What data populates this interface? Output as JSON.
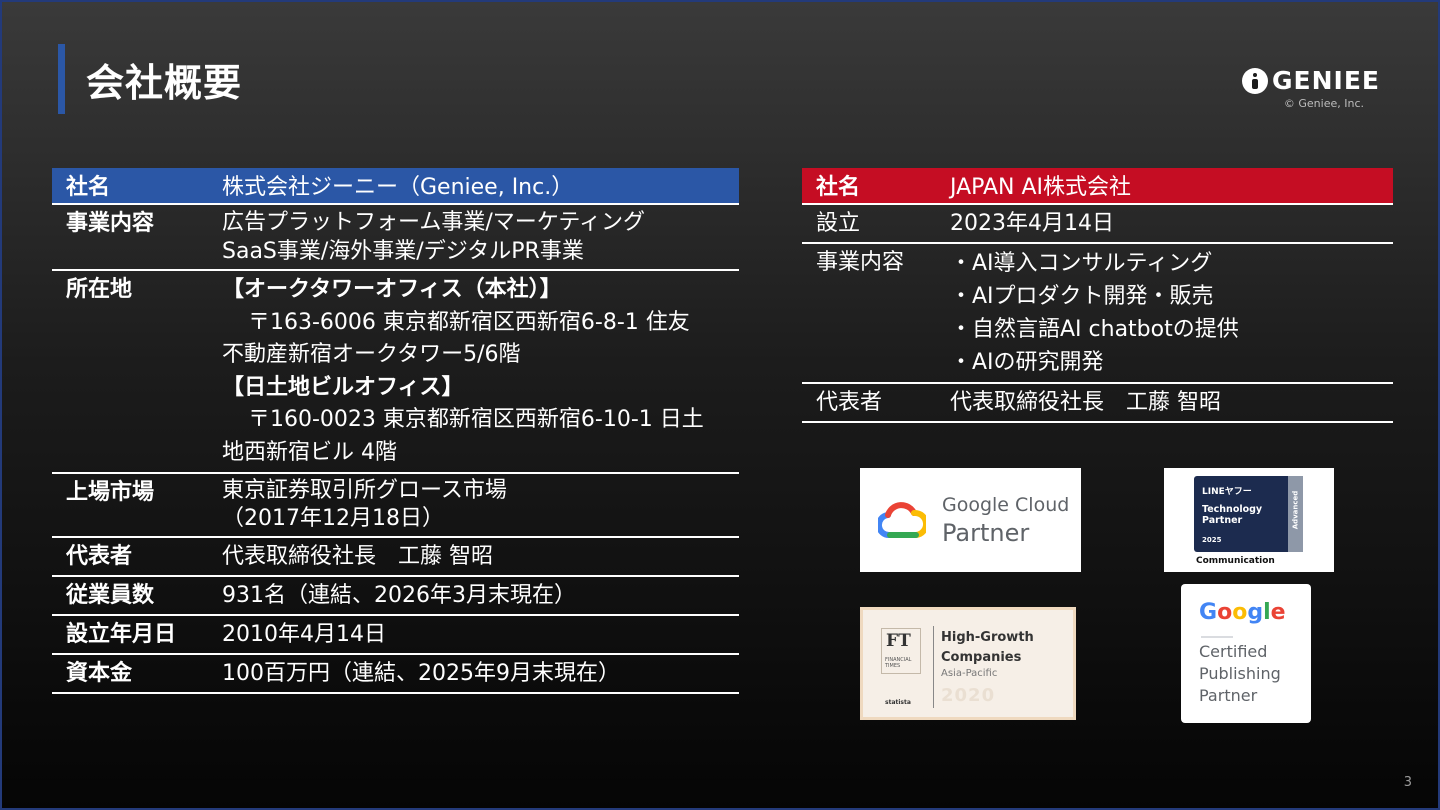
{
  "header": {
    "title": "会社概要",
    "logo_text": "GENIEE",
    "copyright": "© Geniee, Inc."
  },
  "colors": {
    "accent_blue": "#2b57a6",
    "accent_red": "#c50d23"
  },
  "geniee_table": {
    "rows": [
      {
        "label": "社名",
        "lines": [
          "株式会社ジーニー（Geniee, Inc.）"
        ]
      },
      {
        "label": "事業内容",
        "lines": [
          "広告プラットフォーム事業/マーケティング",
          "SaaS事業/海外事業/デジタルPR事業"
        ]
      },
      {
        "label": "所在地",
        "lines": [
          "【オークタワーオフィス（本社）】",
          "〒163-6006 東京都新宿区西新宿6-8-1 住友",
          "不動産新宿オークタワー5/6階",
          "【日土地ビルオフィス】",
          "〒160-0023 東京都新宿区西新宿6-10-1 日土",
          "地西新宿ビル 4階"
        ]
      },
      {
        "label": "上場市場",
        "lines": [
          "東京証券取引所グロース市場",
          "（2017年12月18日）"
        ]
      },
      {
        "label": "代表者",
        "lines": [
          "代表取締役社長　工藤 智昭"
        ]
      },
      {
        "label": "従業員数",
        "lines": [
          "931名（連結、2026年3月末現在）"
        ]
      },
      {
        "label": "設立年月日",
        "lines": [
          "2010年4月14日"
        ]
      },
      {
        "label": "資本金",
        "lines": [
          "100百万円（連結、2025年9月末現在）"
        ]
      }
    ]
  },
  "japanai_table": {
    "rows": [
      {
        "label": "社名",
        "lines": [
          "JAPAN AI株式会社"
        ]
      },
      {
        "label": "設立",
        "lines": [
          "2023年4月14日"
        ]
      },
      {
        "label": "事業内容",
        "lines": [
          "・AI導入コンサルティング",
          "・AIプロダクト開発・販売",
          "・自然言語AI chatbotの提供",
          "・AIの研究開発"
        ]
      },
      {
        "label": "代表者",
        "lines": [
          "代表取締役社長　工藤 智昭"
        ]
      }
    ]
  },
  "badges": {
    "google_cloud": {
      "line1": "Google Cloud",
      "line2": "Partner",
      "icon": "google-cloud-icon"
    },
    "lineyahoo": {
      "brand": "LINEヤフー",
      "line1": "Technology",
      "line2": "Partner",
      "year": "2025",
      "side": "Advanced",
      "category": "Communication"
    },
    "ft": {
      "logo": "FT",
      "small": "FINANCIAL TIMES",
      "line1": "High-Growth",
      "line2": "Companies",
      "region": "Asia-Pacific",
      "year": "2020",
      "statista": "statista"
    },
    "google_publishing": {
      "word": "Google",
      "line1": "Certified",
      "line2": "Publishing",
      "line3": "Partner"
    }
  },
  "page_number": "3"
}
